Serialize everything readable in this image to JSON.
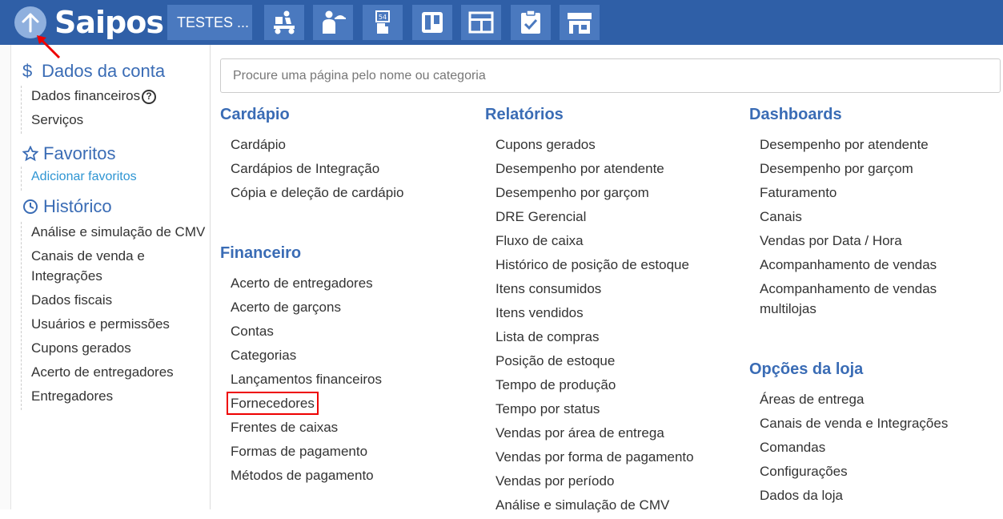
{
  "topbar": {
    "logo": "Saipos",
    "store_label": "TESTES ...",
    "icons": [
      "delivery-icon",
      "waiter-icon",
      "table-tag-icon",
      "kanban-icon",
      "screen-icon",
      "checklist-icon",
      "store-icon"
    ],
    "color": "#2f5fa7"
  },
  "sidebar": {
    "account": {
      "title": "Dados da conta",
      "items": [
        "Dados financeiros",
        "Serviços"
      ]
    },
    "favorites": {
      "title": "Favoritos",
      "add_link": "Adicionar favoritos"
    },
    "history": {
      "title": "Histórico",
      "items": [
        "Análise e simulação de CMV",
        "Canais de venda e Integrações",
        "Dados fiscais",
        "Usuários e permissões",
        "Cupons gerados",
        "Acerto de entregadores",
        "Entregadores"
      ]
    }
  },
  "search": {
    "placeholder": "Procure uma página pelo nome ou categoria"
  },
  "menu": {
    "cardapio": {
      "title": "Cardápio",
      "items": [
        "Cardápio",
        "Cardápios de Integração",
        "Cópia e deleção de cardápio"
      ]
    },
    "financeiro": {
      "title": "Financeiro",
      "items": [
        "Acerto de entregadores",
        "Acerto de garçons",
        "Contas",
        "Categorias",
        "Lançamentos financeiros",
        "Fornecedores",
        "Frentes de caixas",
        "Formas de pagamento",
        "Métodos de pagamento"
      ]
    },
    "relatorios": {
      "title": "Relatórios",
      "items": [
        "Cupons gerados",
        "Desempenho por atendente",
        "Desempenho por garçom",
        "DRE Gerencial",
        "Fluxo de caixa",
        "Histórico de posição de estoque",
        "Itens consumidos",
        "Itens vendidos",
        "Lista de compras",
        "Posição de estoque",
        "Tempo de produção",
        "Tempo por status",
        "Vendas por área de entrega",
        "Vendas por forma de pagamento",
        "Vendas por período",
        "Análise e simulação de CMV"
      ]
    },
    "dashboards": {
      "title": "Dashboards",
      "items": [
        "Desempenho por atendente",
        "Desempenho por garçom",
        "Faturamento",
        "Canais",
        "Vendas por Data / Hora",
        "Acompanhamento de vendas",
        "Acompanhamento de vendas multilojas"
      ]
    },
    "opcoes": {
      "title": "Opções da loja",
      "items": [
        "Áreas de entrega",
        "Canais de venda e Integrações",
        "Comandas",
        "Configurações",
        "Dados da loja"
      ]
    }
  }
}
